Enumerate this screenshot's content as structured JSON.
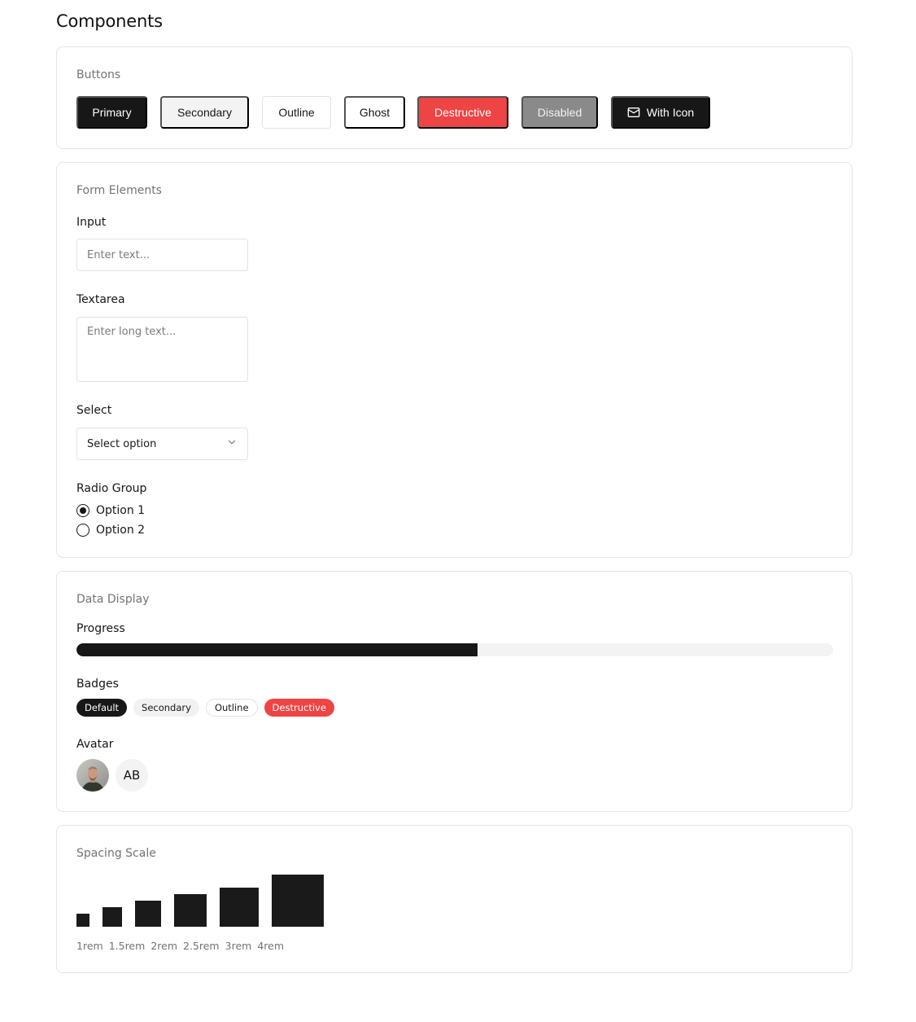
{
  "page": {
    "title": "Components"
  },
  "buttons": {
    "title": "Buttons",
    "primary": "Primary",
    "secondary": "Secondary",
    "outline": "Outline",
    "ghost": "Ghost",
    "destructive": "Destructive",
    "disabled": "Disabled",
    "with_icon": "With Icon",
    "with_icon_icon": "mail-icon"
  },
  "form": {
    "title": "Form Elements",
    "input": {
      "label": "Input",
      "placeholder": "Enter text...",
      "value": ""
    },
    "textarea": {
      "label": "Textarea",
      "placeholder": "Enter long text...",
      "value": ""
    },
    "select": {
      "label": "Select",
      "value": "Select option",
      "icon": "chevron-down-icon"
    },
    "radio_group": {
      "label": "Radio Group",
      "options": [
        {
          "label": "Option 1",
          "checked": true
        },
        {
          "label": "Option 2",
          "checked": false
        }
      ]
    }
  },
  "data_display": {
    "title": "Data Display",
    "progress": {
      "label": "Progress",
      "value_percent": 53
    },
    "badges": {
      "label": "Badges",
      "items": [
        "Default",
        "Secondary",
        "Outline",
        "Destructive"
      ]
    },
    "avatar": {
      "label": "Avatar",
      "image_avatar": "person-photo",
      "initials": "AB"
    }
  },
  "spacing": {
    "title": "Spacing Scale",
    "labels": [
      "1rem",
      "1.5rem",
      "2rem",
      "2.5rem",
      "3rem",
      "4rem"
    ]
  },
  "colors": {
    "primary": "#171717",
    "destructive": "#ef4444",
    "border": "#e5e5e5",
    "muted_text": "#737373",
    "secondary_bg": "#f3f3f3"
  }
}
